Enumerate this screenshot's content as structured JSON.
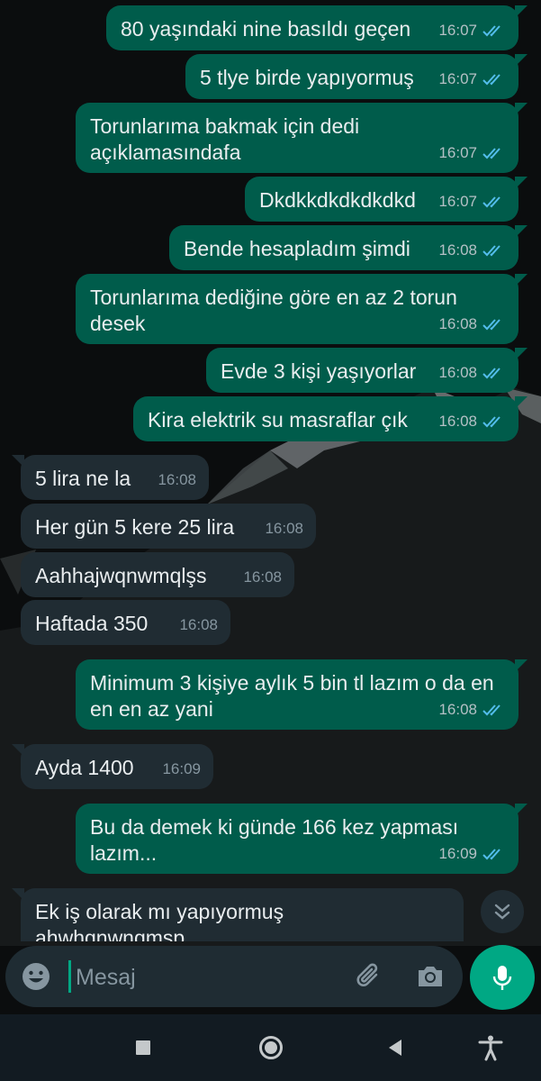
{
  "messages": [
    {
      "dir": "out",
      "text": "80 yaşındaki nine basıldı geçen",
      "time": "16:07"
    },
    {
      "dir": "out",
      "text": "5 tlye birde yapıyormuş",
      "time": "16:07"
    },
    {
      "dir": "out",
      "text": "Torunlarıma bakmak için dedi açıklamasındafa",
      "time": "16:07"
    },
    {
      "dir": "out",
      "text": "Dkdkkdkdkdkdkd",
      "time": "16:07"
    },
    {
      "dir": "out",
      "text": "Bende hesapladım şimdi",
      "time": "16:08"
    },
    {
      "dir": "out",
      "text": "Torunlarıma dediğine göre en az 2 torun desek",
      "time": "16:08"
    },
    {
      "dir": "out",
      "text": "Evde 3 kişi yaşıyorlar",
      "time": "16:08"
    },
    {
      "dir": "out",
      "text": "Kira elektrik su masraflar çık",
      "time": "16:08"
    },
    {
      "dir": "in",
      "text": "5 lira ne la",
      "time": "16:08"
    },
    {
      "dir": "in",
      "text": "Her gün 5 kere 25 lira",
      "time": "16:08"
    },
    {
      "dir": "in",
      "text": "Aahhajwqnwmqlşs",
      "time": "16:08"
    },
    {
      "dir": "in",
      "text": "Haftada 350",
      "time": "16:08"
    },
    {
      "dir": "out",
      "text": "Minimum 3 kişiye aylık 5 bin tl lazım o da en en en az yani",
      "time": "16:08"
    },
    {
      "dir": "in",
      "text": "Ayda 1400",
      "time": "16:09"
    },
    {
      "dir": "out",
      "text": "Bu da demek ki günde 166 kez yapması lazım...",
      "time": "16:09"
    },
    {
      "dir": "in",
      "text": "Ek iş olarak mı yapıyormuş ahwhqnwnqmsp",
      "time": ""
    }
  ],
  "composer": {
    "placeholder": "Mesaj"
  },
  "icons": {
    "emoji": "emoji-icon",
    "attach": "paperclip-icon",
    "camera": "camera-icon",
    "mic": "microphone-icon",
    "scroll": "double-chevron-down-icon"
  },
  "colors": {
    "outgoing": "#005c4b",
    "incoming": "#202c33",
    "accent": "#00a884",
    "read_tick": "#53bdeb"
  }
}
